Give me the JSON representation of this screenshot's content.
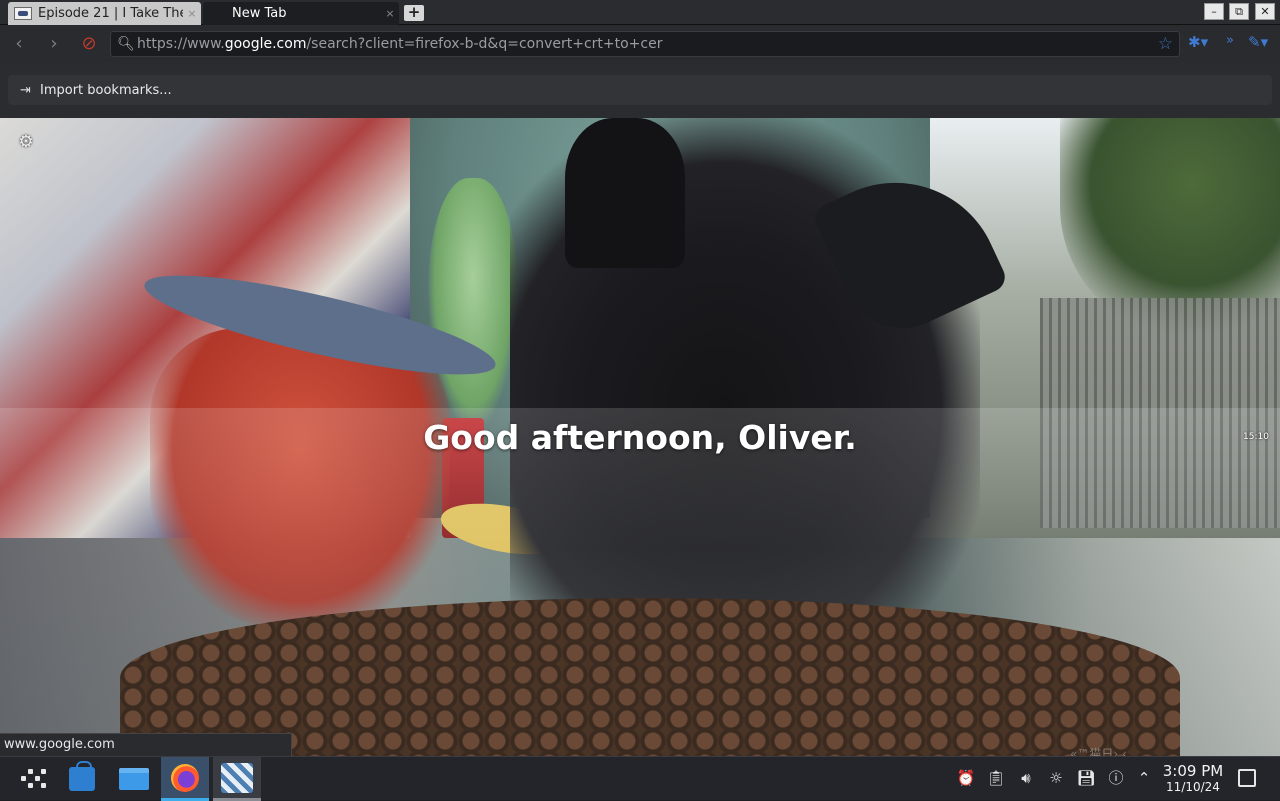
{
  "tabs": [
    {
      "title": "Episode 21 | I Take The",
      "favicon": "anime-site-favicon",
      "active": false
    },
    {
      "title": "New Tab",
      "active": true
    }
  ],
  "tab_close_glyph": "×",
  "new_tab_glyph": "+",
  "window_controls": {
    "minimize": "–",
    "maximize": "⧉",
    "close": "✕"
  },
  "nav": {
    "url_prefix": "https://www.",
    "url_host": "google.com",
    "url_rest": "/search?client=firefox-b-d&q=convert+crt+to+cer"
  },
  "bookmarks": {
    "import_label": "Import bookmarks..."
  },
  "newtab": {
    "greeting": "Good afternoon, Oliver.",
    "mini_clock": "15:10",
    "watermark": "«™猫日›.‹"
  },
  "status_url": "www.google.com",
  "taskbar": {
    "apps": [
      "Application Launcher",
      "Discover",
      "Dolphin",
      "Firefox",
      "Steam"
    ],
    "clock_time": "3:09 PM",
    "clock_date": "11/10/24"
  },
  "colors": {
    "accent": "#3daee9",
    "urlbar_bg": "#1a1b1e",
    "taskbar_bg": "#23252a"
  }
}
